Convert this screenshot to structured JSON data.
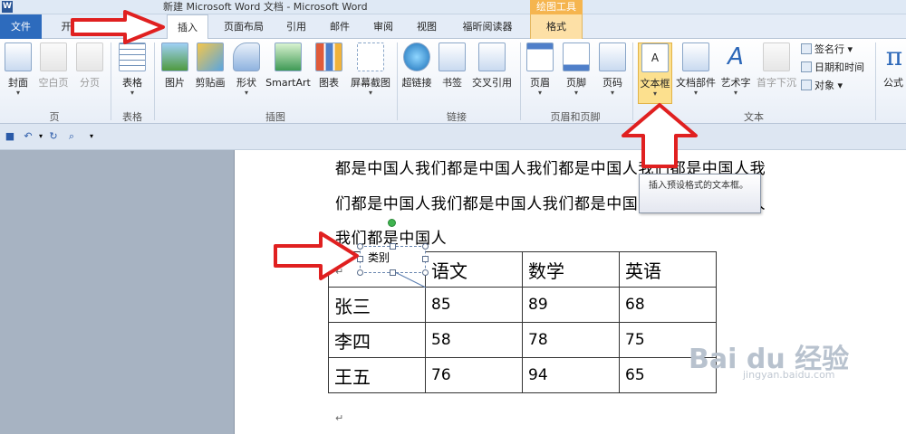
{
  "window": {
    "title": "新建 Microsoft Word 文档 - Microsoft Word",
    "app_icon": "W",
    "tools_caption": "绘图工具"
  },
  "tabs": [
    {
      "label": "文件",
      "active": false
    },
    {
      "label": "开",
      "active": false
    },
    {
      "label": "插入",
      "active": true
    },
    {
      "label": "页面布局",
      "active": false
    },
    {
      "label": "引用",
      "active": false
    },
    {
      "label": "邮件",
      "active": false
    },
    {
      "label": "审阅",
      "active": false
    },
    {
      "label": "视图",
      "active": false
    },
    {
      "label": "福昕阅读器",
      "active": false
    },
    {
      "label": "格式",
      "active": false
    }
  ],
  "ribbon": {
    "groups": {
      "pages": "页",
      "tables": "表格",
      "illustrations": "插图",
      "links": "链接",
      "header_footer": "页眉和页脚",
      "text": "文本"
    },
    "buttons": {
      "cover": "封面",
      "blank_page": "空白页",
      "page_break": "分页",
      "table": "表格",
      "picture": "图片",
      "clip_art": "剪贴画",
      "shapes": "形状",
      "smartart": "SmartArt",
      "chart": "图表",
      "screenshot": "屏幕截图",
      "hyperlink": "超链接",
      "bookmark": "书签",
      "cross_ref": "交叉引用",
      "header": "页眉",
      "footer": "页脚",
      "page_number": "页码",
      "text_box": "文本框",
      "quick_parts": "文档部件",
      "wordart": "艺术字",
      "drop_cap": "首字下沉",
      "signature_line": "签名行",
      "date_time": "日期和时间",
      "object": "对象",
      "equation": "公式"
    }
  },
  "tooltip": "插入预设格式的文本框。",
  "document": {
    "lines": [
      "都是中国人我们都是中国人我们都是中国人我们都是中国人我",
      "们都是中国人我们都是中国人我们都是中国人我们都是中国人",
      "我们都是中国人"
    ],
    "textbox_text": "类别",
    "table": {
      "headers": [
        "",
        "语文",
        "数学",
        "英语"
      ],
      "rows": [
        [
          "张三",
          "85",
          "89",
          "68"
        ],
        [
          "李四",
          "58",
          "78",
          "75"
        ],
        [
          "王五",
          "76",
          "94",
          "65"
        ]
      ]
    }
  },
  "watermark": {
    "brand": "Bai du 经验",
    "url": "jingyan.baidu.com"
  },
  "colors": {
    "file_tab": "#2d6bbd",
    "annotation_arrow": "#e02020",
    "highlight": "#fce08e",
    "tools_caption": "#f5b54f"
  }
}
